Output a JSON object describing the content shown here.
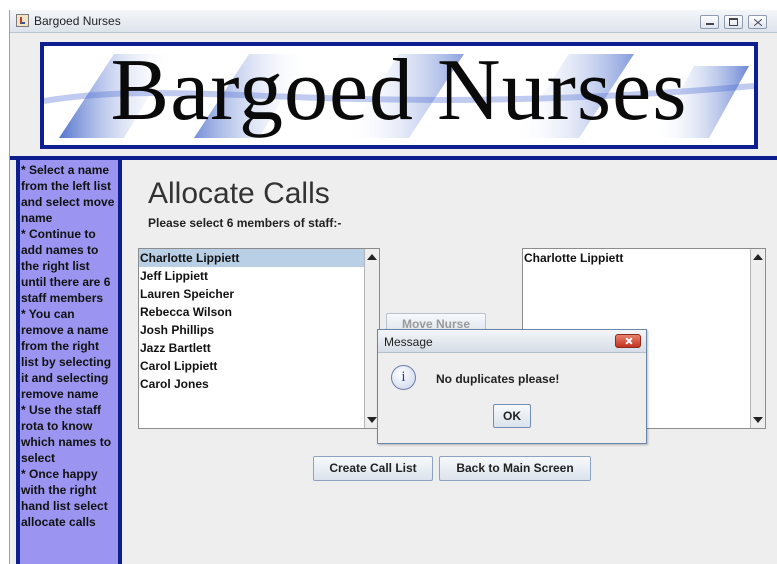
{
  "window": {
    "title": "Bargoed Nurses"
  },
  "banner": {
    "text": "Bargoed Nurses"
  },
  "help": {
    "text": "* Select a name from the left list and select move name\n* Continue to add names to the right list until there are 6 staff members\n* You can remove a name from the right list by selecting it and selecting remove name\n* Use the staff rota to know which names to select\n* Once happy with the right hand list select allocate calls"
  },
  "page": {
    "title": "Allocate Calls",
    "instruction": "Please select 6 members of staff:-"
  },
  "left_list": {
    "items": [
      "Charlotte Lippiett",
      "Jeff Lippiett",
      "Lauren Speicher",
      "Rebecca Wilson",
      "Josh Phillips",
      "Jazz Bartlett",
      "Carol Lippiett",
      "Carol Jones"
    ],
    "selected": 0
  },
  "right_list": {
    "items": [
      "Charlotte Lippiett"
    ]
  },
  "buttons": {
    "move_nurse": "Move Nurse",
    "create_call_list": "Create Call List",
    "back_to_main": "Back to Main Screen"
  },
  "dialog": {
    "title": "Message",
    "message": "No duplicates please!",
    "ok": "OK",
    "icon": "info-icon"
  },
  "colors": {
    "navy": "#0d1f8f",
    "help_panel": "#9b95f1",
    "selection": "#b8cfe5"
  }
}
